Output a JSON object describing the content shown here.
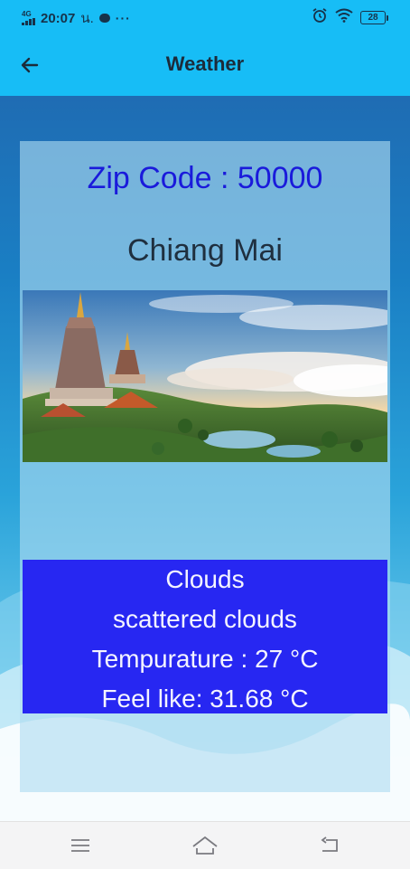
{
  "status_bar": {
    "network": "4G",
    "time": "20:07",
    "suffix": "น.",
    "more": "···",
    "battery": "28"
  },
  "app_bar": {
    "title": "Weather"
  },
  "card": {
    "zip_code": "Zip Code : 50000",
    "city": "Chiang Mai"
  },
  "weather": {
    "main": "Clouds",
    "description": "scattered clouds",
    "temperature": "Tempurature : 27 °C",
    "feels_like": "Feel like: 31.68 °C"
  },
  "colors": {
    "app_bar": "#17bdf6",
    "zip_code_text": "#1a1adb",
    "weather_box": "#2727f2",
    "weather_text": "#f4f4ff"
  },
  "icons": {
    "back": "arrow-back-icon",
    "alarm": "alarm-icon",
    "wifi": "wifi-icon",
    "menu": "menu-icon",
    "home": "home-icon",
    "return": "return-icon"
  }
}
